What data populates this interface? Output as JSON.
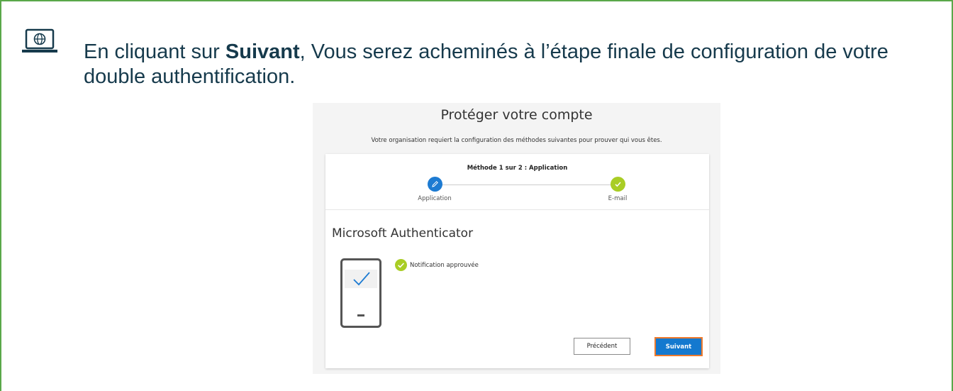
{
  "instruction": {
    "prefix": "En cliquant sur ",
    "bold": "Suivant",
    "suffix": ", Vous serez acheminés à l’étape finale de configuration de votre double authentification."
  },
  "screenshot": {
    "title": "Protéger votre compte",
    "subtitle": "Votre organisation requiert la configuration des méthodes suivantes pour prouver qui vous êtes.",
    "progress": {
      "method_label": "Méthode 1 sur 2 : Application",
      "steps": [
        {
          "label": "Application",
          "icon": "pencil-icon",
          "color": "#1d7bd2"
        },
        {
          "label": "E-mail",
          "icon": "checkmark-icon",
          "color": "#a9cd25"
        }
      ]
    },
    "auth_title": "Microsoft Authenticator",
    "notification": "Notification approuvée",
    "buttons": {
      "previous": "Précédent",
      "next": "Suivant"
    }
  },
  "colors": {
    "frame_border": "#5aa84a",
    "text_primary": "#163a4c",
    "accent_blue": "#1479cf",
    "success_green": "#a9cd25",
    "highlight_orange": "#ee7a2c"
  }
}
